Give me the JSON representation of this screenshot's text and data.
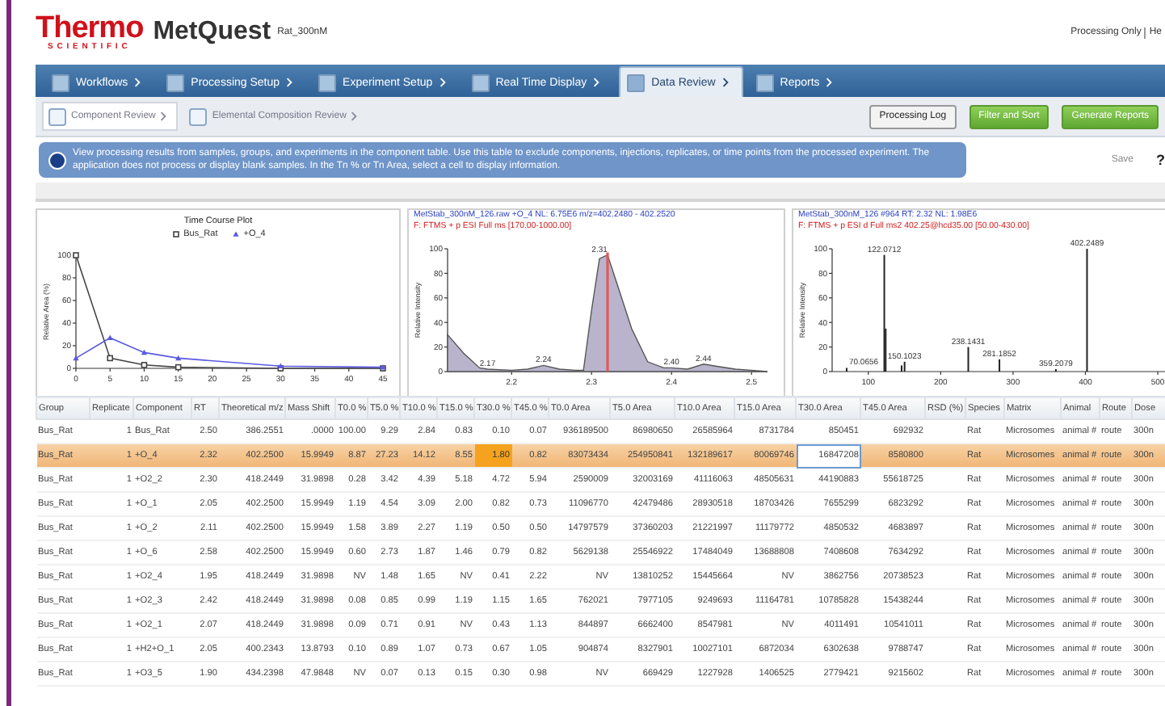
{
  "header": {
    "brand": "Thermo",
    "brand_sub": "SCIENTIFIC",
    "app": "MetQuest",
    "project": "Rat_300nM",
    "top_links": [
      "Processing Only",
      "He"
    ]
  },
  "nav_tabs": [
    {
      "label": "Workflows",
      "selected": false
    },
    {
      "label": "Processing Setup",
      "selected": false
    },
    {
      "label": "Experiment Setup",
      "selected": false
    },
    {
      "label": "Real Time Display",
      "selected": false
    },
    {
      "label": "Data Review",
      "selected": true
    },
    {
      "label": "Reports",
      "selected": false
    }
  ],
  "sub_tabs": [
    {
      "label": "Component Review",
      "selected": true
    },
    {
      "label": "Elemental Composition Review",
      "selected": false
    }
  ],
  "actions": [
    {
      "label": "Processing Log",
      "kind": "plain"
    },
    {
      "label": "Filter and Sort",
      "kind": "green"
    },
    {
      "label": "Generate Reports",
      "kind": "green"
    }
  ],
  "info": "View processing results from samples, groups, and experiments in the component table. Use this table to exclude components, injections, replicates, or time points from the processed experiment. The application does not process or display blank samples. In the Tn % or Tn Area, select a cell to display information.",
  "side_actions": [
    "Save",
    "?"
  ],
  "panels": [
    {
      "title": "Time Course Plot",
      "chart_data": {
        "type": "line",
        "ylabel": "Relative Area (%)",
        "x": [
          0,
          5,
          10,
          15,
          30,
          45
        ],
        "series": [
          {
            "name": "Bus_Rat",
            "color": "#444444",
            "marker": "square",
            "values": [
              100,
              9,
              3,
              1,
              0,
              0
            ]
          },
          {
            "name": "+O_4",
            "color": "#5a5ae0",
            "marker": "triangle",
            "values": [
              9,
              27,
              14,
              9,
              2,
              1
            ]
          }
        ],
        "xlim": [
          0,
          45
        ],
        "ylim": [
          0,
          100
        ],
        "xticks": [
          0,
          5,
          10,
          15,
          20,
          25,
          30,
          35,
          40,
          45
        ],
        "yticks": [
          0,
          20,
          40,
          60,
          80,
          100
        ]
      }
    },
    {
      "header": "MetStab_300nM_126.raw  +O_4  NL: 6.75E6  m/z=402.2480 - 402.2520",
      "filter": "F: FTMS + p ESI Full ms [170.00-1000.00]",
      "chart_data": {
        "type": "area",
        "ylabel": "Relative Intensity",
        "x": [
          2.12,
          2.14,
          2.16,
          2.17,
          2.2,
          2.22,
          2.24,
          2.26,
          2.28,
          2.29,
          2.3,
          2.31,
          2.32,
          2.33,
          2.35,
          2.37,
          2.39,
          2.4,
          2.42,
          2.44,
          2.46,
          2.48,
          2.5,
          2.52
        ],
        "series": [
          {
            "color": "#555555",
            "values": [
              30,
              15,
              3,
              2,
              1,
              2,
              5,
              2,
              1,
              1,
              50,
              92,
              95,
              75,
              35,
              8,
              3,
              3,
              2,
              6,
              4,
              2,
              1,
              0
            ]
          }
        ],
        "xlim": [
          2.12,
          2.52
        ],
        "ylim": [
          0,
          100
        ],
        "xticks": [
          2.2,
          2.3,
          2.4,
          2.5
        ],
        "yticks": [
          0,
          20,
          40,
          60,
          80,
          100
        ],
        "annotations": [
          {
            "x": 2.17,
            "y": 2,
            "text": "2.17"
          },
          {
            "x": 2.24,
            "y": 5,
            "text": "2.24"
          },
          {
            "x": 2.31,
            "y": 95,
            "text": "2.31"
          },
          {
            "x": 2.4,
            "y": 3,
            "text": "2.40"
          },
          {
            "x": 2.44,
            "y": 6,
            "text": "2.44"
          }
        ],
        "ref_lines": [
          {
            "axis": "x",
            "value": 2.32,
            "color": "#e05a5a"
          }
        ]
      }
    },
    {
      "header": "MetStab_300nM_126 #964  RT: 2.32  NL: 1.98E6",
      "filter": "F: FTMS + p ESI d Full ms2 402.25@hcd35.00 [50.00-430.00]",
      "chart_data": {
        "type": "bar",
        "ylabel": "Relative Intensity",
        "x": [
          70.0656,
          122.0712,
          124,
          146,
          150.1023,
          238.1431,
          281.1852,
          359.2079,
          402.2489
        ],
        "series": [
          {
            "color": "#222222",
            "values": [
              3,
              95,
              35,
              5,
              8,
              20,
              10,
              2,
              100
            ]
          }
        ],
        "xlim": [
          50,
          510
        ],
        "ylim": [
          0,
          100
        ],
        "xticks": [
          100,
          200,
          300,
          400,
          500
        ],
        "yticks": [
          0,
          20,
          40,
          60,
          80,
          100
        ],
        "annotations": [
          {
            "x": 70.0656,
            "y": 3,
            "text": "70.0656"
          },
          {
            "x": 122.0712,
            "y": 95,
            "text": "122.0712"
          },
          {
            "x": 150.1023,
            "y": 8,
            "text": "150.1023"
          },
          {
            "x": 238.1431,
            "y": 20,
            "text": "238.1431"
          },
          {
            "x": 281.1852,
            "y": 10,
            "text": "281.1852"
          },
          {
            "x": 359.2079,
            "y": 2,
            "text": "359.2079"
          },
          {
            "x": 402.2489,
            "y": 100,
            "text": "402.2489"
          }
        ]
      }
    }
  ],
  "table": {
    "columns": [
      "Group",
      "Replicate",
      "Component",
      "RT",
      "Theoretical m/z",
      "Mass Shift",
      "T0.0 %",
      "T5.0 %",
      "T10.0 %",
      "T15.0 %",
      "T30.0 %",
      "T45.0 %",
      "T0.0 Area",
      "T5.0 Area",
      "T10.0 Area",
      "T15.0 Area",
      "T30.0 Area",
      "T45.0 Area",
      "RSD (%)",
      "Species",
      "Matrix",
      "Animal",
      "Route",
      "Dose"
    ],
    "rows": [
      {
        "selected": false,
        "cells": [
          "Bus_Rat",
          "1",
          "Bus_Rat",
          "2.50",
          "386.2551",
          ".0000",
          "100.00",
          "9.29",
          "2.84",
          "0.83",
          "0.10",
          "0.07",
          "936189500",
          "86980650",
          "26585964",
          "8731784",
          "850451",
          "692932",
          "",
          "Rat",
          "Microsomes",
          "animal #",
          "route",
          "300n"
        ]
      },
      {
        "selected": true,
        "cells": [
          "Bus_Rat",
          "1",
          "+O_4",
          "2.32",
          "402.2500",
          "15.9949",
          "8.87",
          "27.23",
          "14.12",
          "8.55",
          {
            "text": "1.80",
            "highlighted": true
          },
          "0.82",
          "83073434",
          "254950841",
          "132189617",
          "80069746",
          {
            "text": "16847208",
            "focused": true
          },
          "8580800",
          "",
          "Rat",
          "Microsomes",
          "animal #",
          "route",
          "300n"
        ]
      },
      {
        "selected": false,
        "cells": [
          "Bus_Rat",
          "1",
          "+O2_2",
          "2.30",
          "418.2449",
          "31.9898",
          "0.28",
          "3.42",
          "4.39",
          "5.18",
          "4.72",
          "5.94",
          "2590009",
          "32003169",
          "41116063",
          "48505631",
          "44190883",
          "55618725",
          "",
          "Rat",
          "Microsomes",
          "animal #",
          "route",
          "300n"
        ]
      },
      {
        "selected": false,
        "cells": [
          "Bus_Rat",
          "1",
          "+O_1",
          "2.05",
          "402.2500",
          "15.9949",
          "1.19",
          "4.54",
          "3.09",
          "2.00",
          "0.82",
          "0.73",
          "11096770",
          "42479486",
          "28930518",
          "18703426",
          "7655299",
          "6823292",
          "",
          "Rat",
          "Microsomes",
          "animal #",
          "route",
          "300n"
        ]
      },
      {
        "selected": false,
        "cells": [
          "Bus_Rat",
          "1",
          "+O_2",
          "2.11",
          "402.2500",
          "15.9949",
          "1.58",
          "3.89",
          "2.27",
          "1.19",
          "0.50",
          "0.50",
          "14797579",
          "37360203",
          "21221997",
          "11179772",
          "4850532",
          "4683897",
          "",
          "Rat",
          "Microsomes",
          "animal #",
          "route",
          "300n"
        ]
      },
      {
        "selected": false,
        "cells": [
          "Bus_Rat",
          "1",
          "+O_6",
          "2.58",
          "402.2500",
          "15.9949",
          "0.60",
          "2.73",
          "1.87",
          "1.46",
          "0.79",
          "0.82",
          "5629138",
          "25546922",
          "17484049",
          "13688808",
          "7408608",
          "7634292",
          "",
          "Rat",
          "Microsomes",
          "animal #",
          "route",
          "300n"
        ]
      },
      {
        "selected": false,
        "cells": [
          "Bus_Rat",
          "1",
          "+O2_4",
          "1.95",
          "418.2449",
          "31.9898",
          "NV",
          "1.48",
          "1.65",
          "NV",
          "0.41",
          "2.22",
          "NV",
          "13810252",
          "15445664",
          "NV",
          "3862756",
          "20738523",
          "",
          "Rat",
          "Microsomes",
          "animal #",
          "route",
          "300n"
        ]
      },
      {
        "selected": false,
        "cells": [
          "Bus_Rat",
          "1",
          "+O2_3",
          "2.42",
          "418.2449",
          "31.9898",
          "0.08",
          "0.85",
          "0.99",
          "1.19",
          "1.15",
          "1.65",
          "762021",
          "7977105",
          "9249693",
          "11164781",
          "10785828",
          "15438244",
          "",
          "Rat",
          "Microsomes",
          "animal #",
          "route",
          "300n"
        ]
      },
      {
        "selected": false,
        "cells": [
          "Bus_Rat",
          "1",
          "+O2_1",
          "2.07",
          "418.2449",
          "31.9898",
          "0.09",
          "0.71",
          "0.91",
          "NV",
          "0.43",
          "1.13",
          "844897",
          "6662400",
          "8547981",
          "NV",
          "4011491",
          "10541011",
          "",
          "Rat",
          "Microsomes",
          "animal #",
          "route",
          "300n"
        ]
      },
      {
        "selected": false,
        "cells": [
          "Bus_Rat",
          "1",
          "+H2+O_1",
          "2.05",
          "400.2343",
          "13.8793",
          "0.10",
          "0.89",
          "1.07",
          "0.73",
          "0.67",
          "1.05",
          "904874",
          "8327901",
          "10027101",
          "6872034",
          "6302638",
          "9788747",
          "",
          "Rat",
          "Microsomes",
          "animal #",
          "route",
          "300n"
        ]
      },
      {
        "selected": false,
        "cells": [
          "Bus_Rat",
          "1",
          "+O3_5",
          "1.90",
          "434.2398",
          "47.9848",
          "NV",
          "0.07",
          "0.13",
          "0.15",
          "0.30",
          "0.98",
          "NV",
          "669429",
          "1227928",
          "1406525",
          "2779421",
          "9215602",
          "",
          "Rat",
          "Microsomes",
          "animal #",
          "route",
          "300n"
        ]
      }
    ]
  }
}
